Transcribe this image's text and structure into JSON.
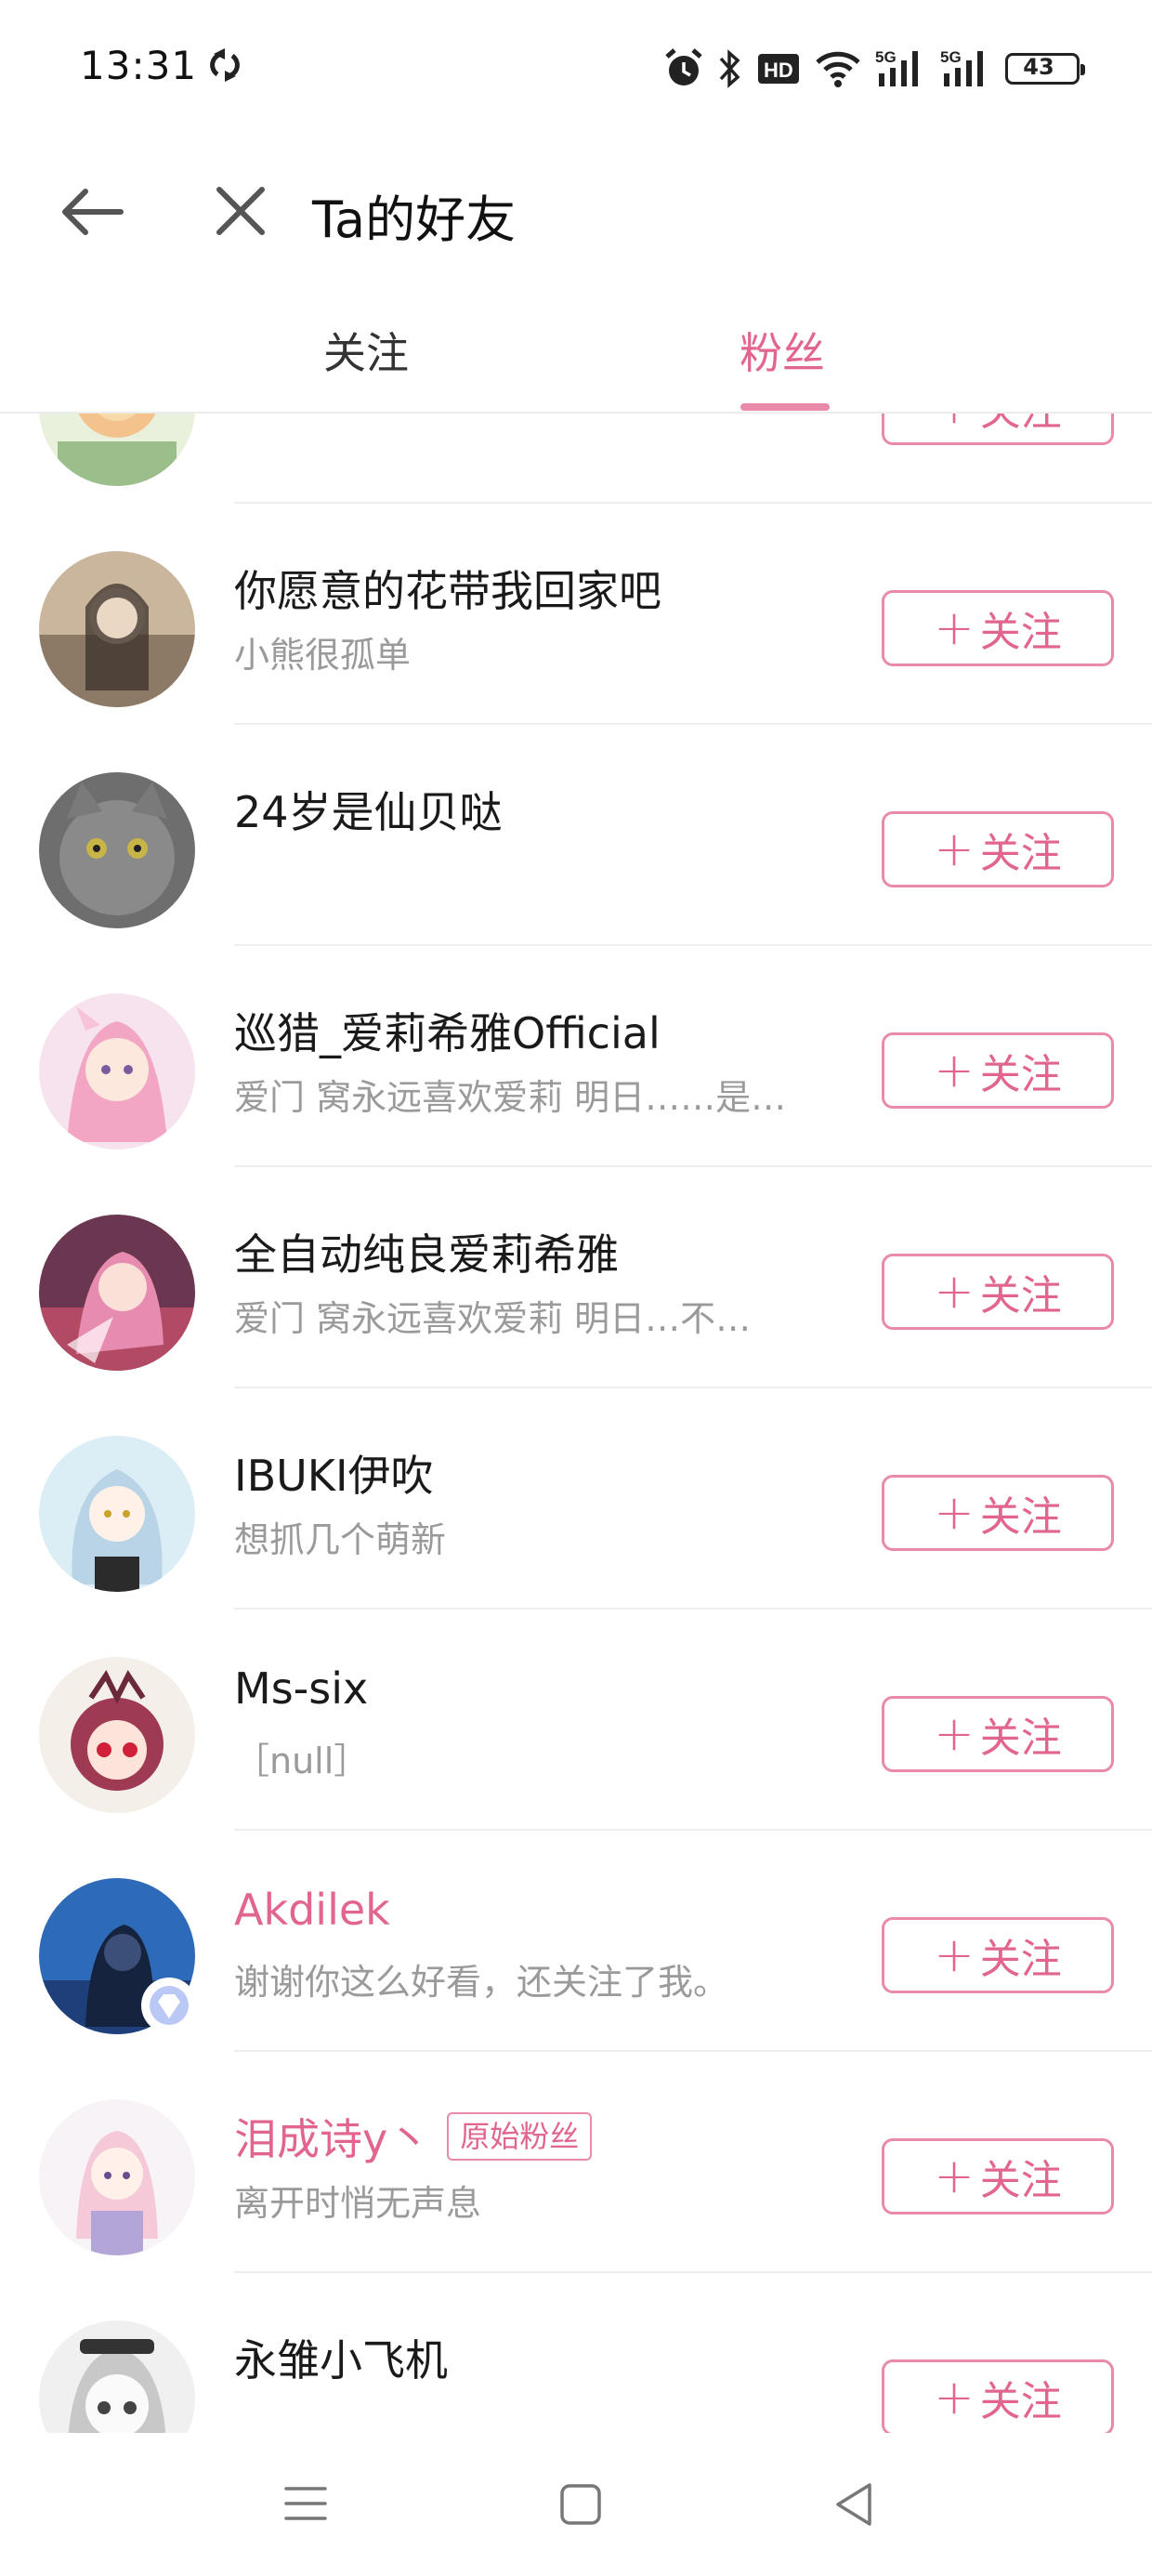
{
  "status_bar": {
    "time": "13:31",
    "battery": "43",
    "icons": [
      "alarm-icon",
      "bluetooth-icon",
      "hd-icon",
      "wifi-icon",
      "signal-5g-icon",
      "signal-5g-icon",
      "battery-icon"
    ]
  },
  "header": {
    "title": "Ta的好友"
  },
  "tabs": [
    {
      "label": "关注",
      "active": false
    },
    {
      "label": "粉丝",
      "active": true
    }
  ],
  "follow_label": "关注",
  "accent_color": "#e1658f",
  "users": [
    {
      "name": "",
      "subtitle": "",
      "name_color": "default",
      "badge": ""
    },
    {
      "name": "你愿意的花带我回家吧",
      "subtitle": "小熊很孤单",
      "name_color": "default",
      "badge": ""
    },
    {
      "name": "24岁是仙贝哒",
      "subtitle": "",
      "name_color": "default",
      "badge": ""
    },
    {
      "name": "巡猎_爱莉希雅Official",
      "subtitle": "爱门 窝永远喜欢爱莉 明日……是…",
      "name_color": "default",
      "badge": ""
    },
    {
      "name": "全自动纯良爱莉希雅",
      "subtitle": "爱门 窝永远喜欢爱莉 明日…不…",
      "name_color": "default",
      "badge": ""
    },
    {
      "name": "IBUKI伊吹",
      "subtitle": "想抓几个萌新",
      "name_color": "default",
      "badge": ""
    },
    {
      "name": "Ms-six",
      "subtitle": "［null］",
      "name_color": "default",
      "badge": ""
    },
    {
      "name": "Akdilek",
      "subtitle": "谢谢你这么好看，还关注了我。",
      "name_color": "pink",
      "badge": "",
      "verified": true
    },
    {
      "name": "泪成诗y丶",
      "subtitle": "离开时悄无声息",
      "name_color": "pink",
      "badge": "原始粉丝"
    },
    {
      "name": "永雏小飞机",
      "subtitle": "",
      "name_color": "default",
      "badge": ""
    }
  ],
  "nav_bar": {
    "icons": [
      "menu-icon",
      "home-square-icon",
      "back-triangle-icon"
    ]
  }
}
